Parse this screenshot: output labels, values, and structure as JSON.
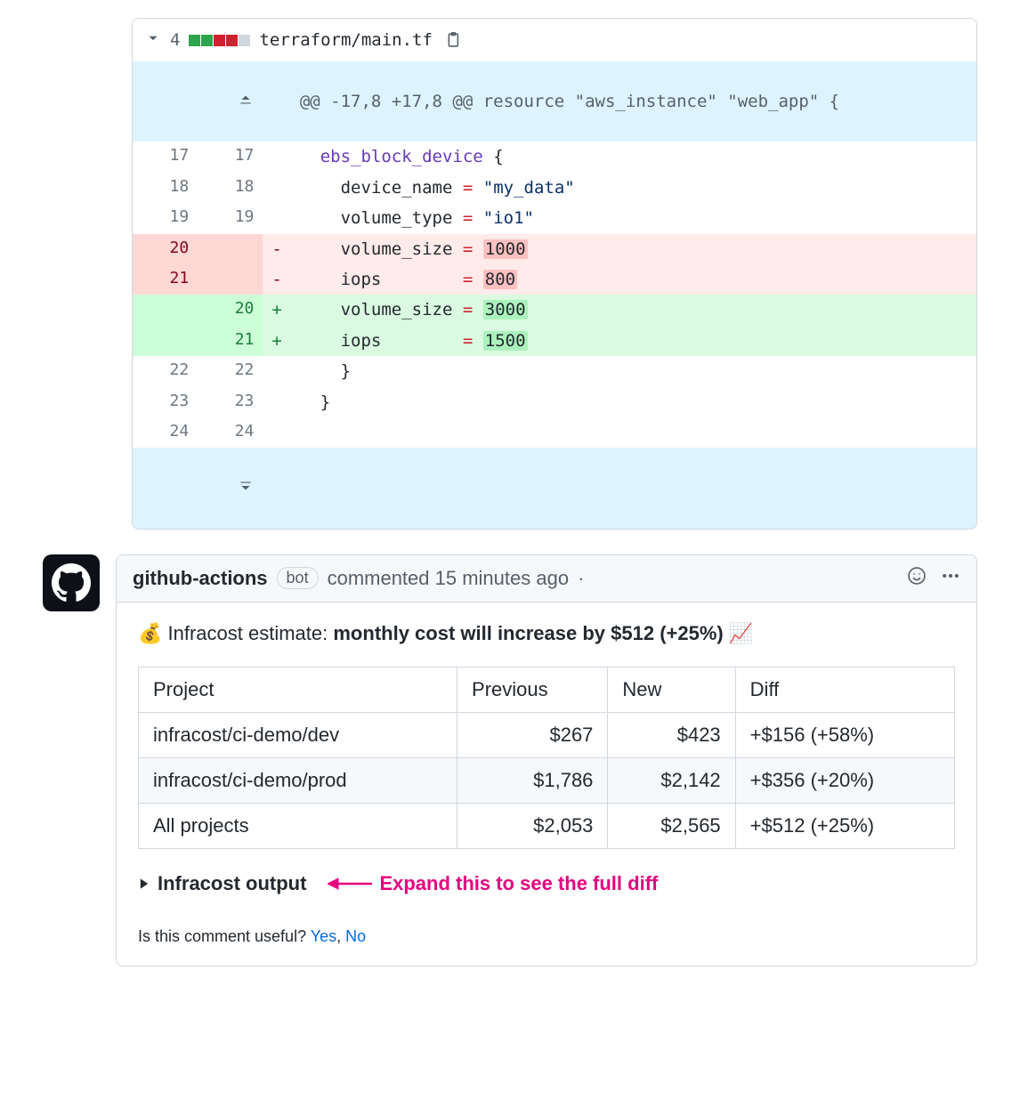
{
  "diff": {
    "changeCount": "4",
    "filename": "terraform/main.tf",
    "hunkHeader": "@@ -17,8 +17,8 @@ resource \"aws_instance\" \"web_app\" {",
    "lines": {
      "l17_old": "17",
      "l17_new": "17",
      "l18_old": "18",
      "l18_new": "18",
      "l19_old": "19",
      "l19_new": "19",
      "l20_old": "20",
      "l21_old": "21",
      "l20_new": "20",
      "l21_new": "21",
      "l22_old": "22",
      "l22_new": "22",
      "l23_old": "23",
      "l23_new": "23",
      "l24_old": "24",
      "l24_new": "24"
    },
    "tokens": {
      "ebs": "ebs_block_device",
      "brace_open": " {",
      "device_name_k": "device_name",
      "eq": " = ",
      "device_name_v": "\"my_data\"",
      "volume_type_k": "volume_type",
      "volume_type_v": "\"io1\"",
      "volume_size_k": "volume_size",
      "iops_k": "iops       ",
      "iops_k2": "iops       ",
      "vs_old": "1000",
      "iops_old": "800",
      "vs_new": "3000",
      "iops_new": "1500",
      "brace_close1": "    }",
      "brace_close2": "  }",
      "minus": "-",
      "plus": "+"
    }
  },
  "comment": {
    "author": "github-actions",
    "badge": "bot",
    "timeText": "commented 15 minutes ago",
    "dot": "·",
    "moneyEmoji": "💰",
    "headlinePrefix": " Infracost estimate: ",
    "headlineBold": "monthly cost will increase by $512 (+25%)",
    "chartEmoji": " 📈",
    "table": {
      "h_project": "Project",
      "h_prev": "Previous",
      "h_new": "New",
      "h_diff": "Diff",
      "rows": [
        {
          "project": "infracost/ci-demo/dev",
          "prev": "$267",
          "new": "$423",
          "diff": "+$156 (+58%)"
        },
        {
          "project": "infracost/ci-demo/prod",
          "prev": "$1,786",
          "new": "$2,142",
          "diff": "+$356 (+20%)"
        },
        {
          "project": "All projects",
          "prev": "$2,053",
          "new": "$2,565",
          "diff": "+$512 (+25%)"
        }
      ]
    },
    "detailsLabel": "Infracost output",
    "annotation": "Expand this to see the full diff",
    "feedbackText": "Is this comment useful? ",
    "yes": "Yes",
    "comma": ", ",
    "no": "No"
  }
}
